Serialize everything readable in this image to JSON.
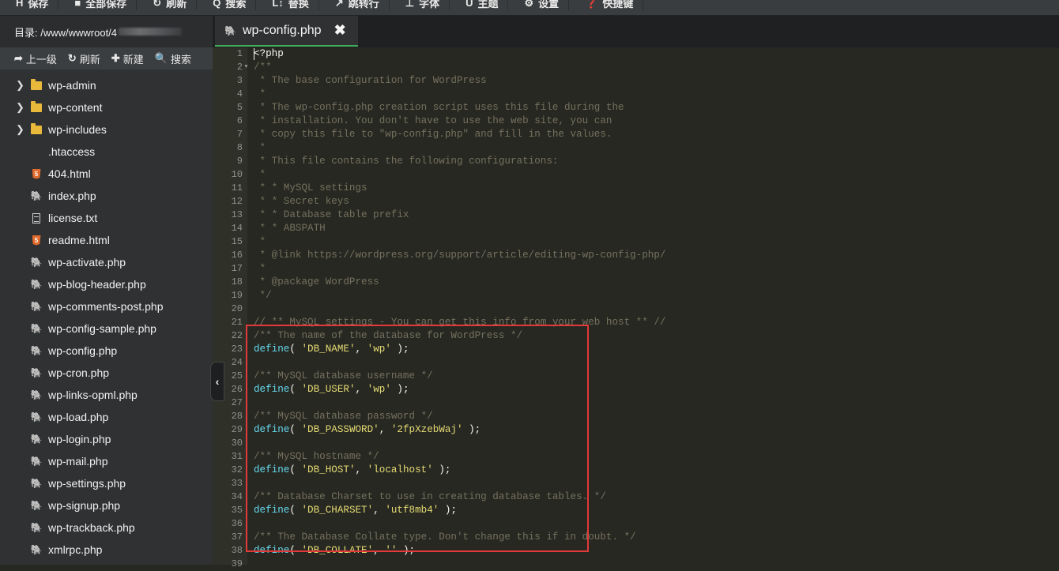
{
  "toolbar": {
    "buttons": [
      {
        "label": "保存",
        "icon": "save-icon",
        "glyph": "H"
      },
      {
        "label": "全部保存",
        "icon": "save-all-icon",
        "glyph": "■"
      },
      {
        "label": "刷新",
        "icon": "refresh-icon",
        "glyph": "↻"
      },
      {
        "label": "搜索",
        "icon": "search-icon",
        "glyph": "Q"
      },
      {
        "label": "替换",
        "icon": "replace-icon",
        "glyph": "L↕"
      },
      {
        "label": "跳转行",
        "icon": "goto-line-icon",
        "glyph": "↗"
      },
      {
        "label": "字体",
        "icon": "font-icon",
        "glyph": "⊥"
      },
      {
        "label": "主题",
        "icon": "theme-icon",
        "glyph": "U"
      },
      {
        "label": "设置",
        "icon": "gear-icon",
        "glyph": "⚙"
      },
      {
        "label": "快捷键",
        "icon": "help-icon",
        "glyph": "❓"
      }
    ]
  },
  "sidebar": {
    "directory_label": "目录: /www/wwwroot/4",
    "actions": [
      {
        "label": "上一级",
        "glyph": "➦",
        "icon": "up-level-icon"
      },
      {
        "label": "刷新",
        "glyph": "↻",
        "icon": "refresh-icon"
      },
      {
        "label": "新建",
        "glyph": "✚",
        "icon": "new-file-icon"
      },
      {
        "label": "搜索",
        "glyph": "🔍",
        "icon": "search-icon"
      }
    ],
    "files": [
      {
        "name": "wp-admin",
        "type": "folder"
      },
      {
        "name": "wp-content",
        "type": "folder"
      },
      {
        "name": "wp-includes",
        "type": "folder"
      },
      {
        "name": ".htaccess",
        "type": "none"
      },
      {
        "name": "404.html",
        "type": "html"
      },
      {
        "name": "index.php",
        "type": "php"
      },
      {
        "name": "license.txt",
        "type": "txt"
      },
      {
        "name": "readme.html",
        "type": "html"
      },
      {
        "name": "wp-activate.php",
        "type": "php"
      },
      {
        "name": "wp-blog-header.php",
        "type": "php"
      },
      {
        "name": "wp-comments-post.php",
        "type": "php"
      },
      {
        "name": "wp-config-sample.php",
        "type": "php"
      },
      {
        "name": "wp-config.php",
        "type": "php"
      },
      {
        "name": "wp-cron.php",
        "type": "php"
      },
      {
        "name": "wp-links-opml.php",
        "type": "php"
      },
      {
        "name": "wp-load.php",
        "type": "php"
      },
      {
        "name": "wp-login.php",
        "type": "php"
      },
      {
        "name": "wp-mail.php",
        "type": "php"
      },
      {
        "name": "wp-settings.php",
        "type": "php"
      },
      {
        "name": "wp-signup.php",
        "type": "php"
      },
      {
        "name": "wp-trackback.php",
        "type": "php"
      },
      {
        "name": "xmlrpc.php",
        "type": "php"
      }
    ]
  },
  "tab": {
    "title": "wp-config.php",
    "close": "✖"
  },
  "editor": {
    "lines": [
      [
        [
          "pt",
          "<?php"
        ]
      ],
      [
        [
          "cm",
          "/**"
        ]
      ],
      [
        [
          "cm",
          " * The base configuration for WordPress"
        ]
      ],
      [
        [
          "cm",
          " *"
        ]
      ],
      [
        [
          "cm",
          " * The wp-config.php creation script uses this file during the"
        ]
      ],
      [
        [
          "cm",
          " * installation. You don't have to use the web site, you can"
        ]
      ],
      [
        [
          "cm",
          " * copy this file to \"wp-config.php\" and fill in the values."
        ]
      ],
      [
        [
          "cm",
          " *"
        ]
      ],
      [
        [
          "cm",
          " * This file contains the following configurations:"
        ]
      ],
      [
        [
          "cm",
          " *"
        ]
      ],
      [
        [
          "cm",
          " * * MySQL settings"
        ]
      ],
      [
        [
          "cm",
          " * * Secret keys"
        ]
      ],
      [
        [
          "cm",
          " * * Database table prefix"
        ]
      ],
      [
        [
          "cm",
          " * * ABSPATH"
        ]
      ],
      [
        [
          "cm",
          " *"
        ]
      ],
      [
        [
          "cm",
          " * @link https://wordpress.org/support/article/editing-wp-config-php/"
        ]
      ],
      [
        [
          "cm",
          " *"
        ]
      ],
      [
        [
          "cm",
          " * @package WordPress"
        ]
      ],
      [
        [
          "cm",
          " */"
        ]
      ],
      [],
      [
        [
          "cm",
          "// ** MySQL settings - You can get this info from your web host ** //"
        ]
      ],
      [
        [
          "cm",
          "/** The name of the database for WordPress */"
        ]
      ],
      [
        [
          "kw",
          "define"
        ],
        [
          "pt",
          "( "
        ],
        [
          "st",
          "'DB_NAME'"
        ],
        [
          "pt",
          ", "
        ],
        [
          "st",
          "'wp'"
        ],
        [
          "pt",
          " );"
        ]
      ],
      [],
      [
        [
          "cm",
          "/** MySQL database username */"
        ]
      ],
      [
        [
          "kw",
          "define"
        ],
        [
          "pt",
          "( "
        ],
        [
          "st",
          "'DB_USER'"
        ],
        [
          "pt",
          ", "
        ],
        [
          "st",
          "'wp'"
        ],
        [
          "pt",
          " );"
        ]
      ],
      [],
      [
        [
          "cm",
          "/** MySQL database password */"
        ]
      ],
      [
        [
          "kw",
          "define"
        ],
        [
          "pt",
          "( "
        ],
        [
          "st",
          "'DB_PASSWORD'"
        ],
        [
          "pt",
          ", "
        ],
        [
          "st",
          "'2fpXzebWaj'"
        ],
        [
          "pt",
          " );"
        ]
      ],
      [],
      [
        [
          "cm",
          "/** MySQL hostname */"
        ]
      ],
      [
        [
          "kw",
          "define"
        ],
        [
          "pt",
          "( "
        ],
        [
          "st",
          "'DB_HOST'"
        ],
        [
          "pt",
          ", "
        ],
        [
          "st",
          "'localhost'"
        ],
        [
          "pt",
          " );"
        ]
      ],
      [],
      [
        [
          "cm",
          "/** Database Charset to use in creating database tables. */"
        ]
      ],
      [
        [
          "kw",
          "define"
        ],
        [
          "pt",
          "( "
        ],
        [
          "st",
          "'DB_CHARSET'"
        ],
        [
          "pt",
          ", "
        ],
        [
          "st",
          "'utf8mb4'"
        ],
        [
          "pt",
          " );"
        ]
      ],
      [],
      [
        [
          "cm",
          "/** The Database Collate type. Don't change this if in doubt. */"
        ]
      ],
      [
        [
          "kw",
          "define"
        ],
        [
          "pt",
          "( "
        ],
        [
          "st",
          "'DB_COLLATE'"
        ],
        [
          "pt",
          ", "
        ],
        [
          "st",
          "''"
        ],
        [
          "pt",
          " );"
        ]
      ],
      []
    ]
  }
}
